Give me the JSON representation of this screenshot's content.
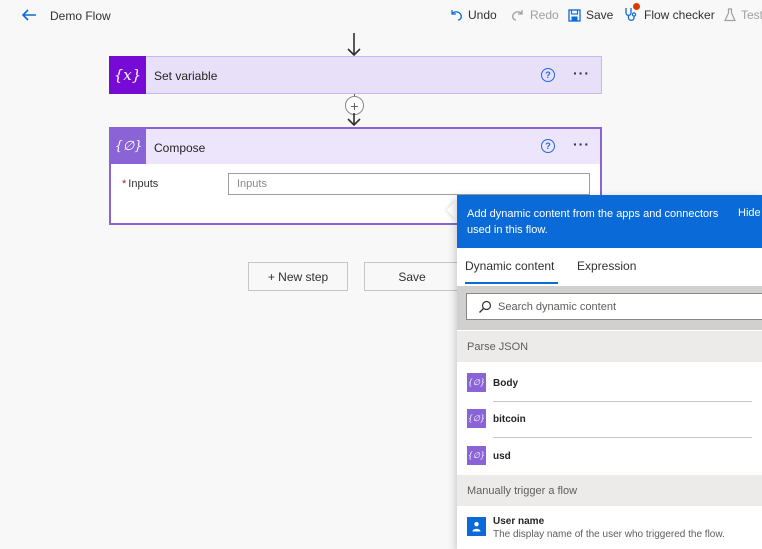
{
  "header": {
    "title": "Demo Flow",
    "undo": "Undo",
    "redo": "Redo",
    "save": "Save",
    "flow_checker": "Flow checker",
    "test": "Test"
  },
  "steps": {
    "set_variable": {
      "title": "Set variable",
      "icon": "{x}"
    },
    "compose": {
      "title": "Compose",
      "icon": "{∅}",
      "inputs_label": "Inputs",
      "required_marker": "*",
      "inputs_placeholder": "Inputs"
    }
  },
  "canvas_buttons": {
    "new_step": "+ New step",
    "save": "Save"
  },
  "dynamic_panel": {
    "header_text": "Add dynamic content from the apps and connectors used in this flow.",
    "hide": "Hide",
    "tabs": [
      "Dynamic content",
      "Expression"
    ],
    "active_tab": "Dynamic content",
    "search_placeholder": "Search dynamic content",
    "groups": [
      {
        "title": "Parse JSON",
        "items": [
          "Body",
          "bitcoin",
          "usd"
        ]
      },
      {
        "title": "Manually trigger a flow",
        "items": [
          {
            "label": "User name",
            "description": "The display name of the user who triggered the flow."
          }
        ]
      }
    ]
  },
  "colors": {
    "accent": "#0a6bd8",
    "set_variable": "#770bd6",
    "compose": "#8a63d7",
    "checker_badge": "#d83b01"
  }
}
